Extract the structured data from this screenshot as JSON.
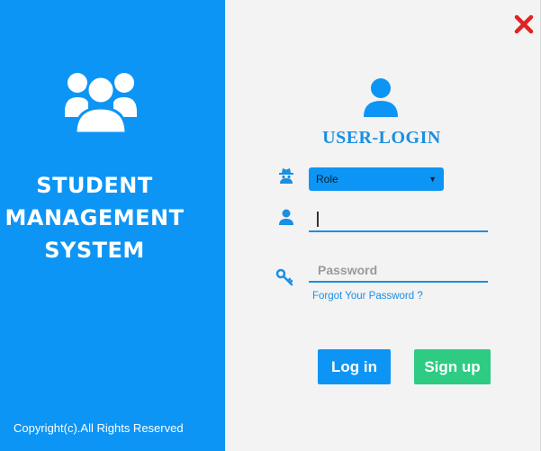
{
  "left_panel": {
    "title_lines": [
      "STUDENT",
      "MANAGEMENT",
      "SYSTEM"
    ],
    "copyright": "Copyright(c).All Rights Reserved",
    "icon": "users-group-icon",
    "background": "#0d95f5"
  },
  "login": {
    "title": "USER-LOGIN",
    "header_icon": "user-icon",
    "role": {
      "selected": "Role",
      "icon": "spy-icon"
    },
    "username": {
      "value": "",
      "icon": "user-icon"
    },
    "password": {
      "placeholder": "Password",
      "icon": "key-icon"
    },
    "forgot_label": "Forgot Your Password ?",
    "login_label": "Log in",
    "signup_label": "Sign up",
    "close_icon": "close-icon"
  },
  "colors": {
    "accent": "#0d95f5",
    "signup": "#2ecb83",
    "close": "#e02424",
    "panel_bg": "#f3f3f3"
  }
}
